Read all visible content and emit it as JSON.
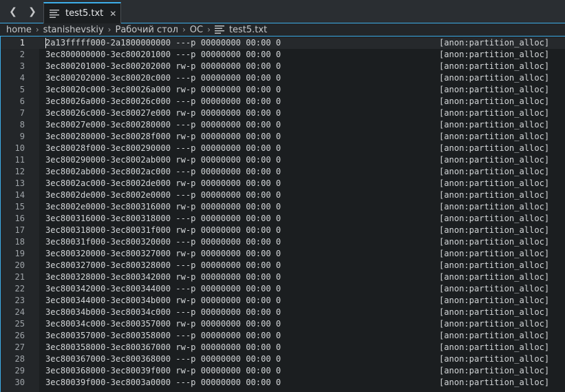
{
  "tab": {
    "label": "test5.txt",
    "close": "✕"
  },
  "nav": {
    "back": "❮",
    "forward": "❯"
  },
  "icons": {
    "back": "chevron-left-icon",
    "forward": "chevron-right-icon",
    "document": "document-text-icon",
    "close": "close-icon",
    "separator": "chevron-right-icon"
  },
  "colors": {
    "accent": "#3daee9",
    "background": "#1b1e20",
    "text": "#d3d6d8"
  },
  "breadcrumb": [
    "home",
    "stanishevskiy",
    "Рабочий стол",
    "ОС",
    "test5.txt"
  ],
  "breadcrumb_sep": "›",
  "lines": [
    {
      "num": "1",
      "text": "2a13fffff000-2a1800000000 ---p 00000000 00:00 0",
      "tag": "[anon:partition_alloc]"
    },
    {
      "num": "2",
      "text": "3ec800000000-3ec800201000 ---p 00000000 00:00 0",
      "tag": "[anon:partition_alloc]"
    },
    {
      "num": "3",
      "text": "3ec800201000-3ec800202000 rw-p 00000000 00:00 0",
      "tag": "[anon:partition_alloc]"
    },
    {
      "num": "4",
      "text": "3ec800202000-3ec80020c000 ---p 00000000 00:00 0",
      "tag": "[anon:partition_alloc]"
    },
    {
      "num": "5",
      "text": "3ec80020c000-3ec80026a000 rw-p 00000000 00:00 0",
      "tag": "[anon:partition_alloc]"
    },
    {
      "num": "6",
      "text": "3ec80026a000-3ec80026c000 ---p 00000000 00:00 0",
      "tag": "[anon:partition_alloc]"
    },
    {
      "num": "7",
      "text": "3ec80026c000-3ec80027e000 rw-p 00000000 00:00 0",
      "tag": "[anon:partition_alloc]"
    },
    {
      "num": "8",
      "text": "3ec80027e000-3ec800280000 ---p 00000000 00:00 0",
      "tag": "[anon:partition_alloc]"
    },
    {
      "num": "9",
      "text": "3ec800280000-3ec80028f000 rw-p 00000000 00:00 0",
      "tag": "[anon:partition_alloc]"
    },
    {
      "num": "10",
      "text": "3ec80028f000-3ec800290000 ---p 00000000 00:00 0",
      "tag": "[anon:partition_alloc]"
    },
    {
      "num": "11",
      "text": "3ec800290000-3ec8002ab000 rw-p 00000000 00:00 0",
      "tag": "[anon:partition_alloc]"
    },
    {
      "num": "12",
      "text": "3ec8002ab000-3ec8002ac000 ---p 00000000 00:00 0",
      "tag": "[anon:partition_alloc]"
    },
    {
      "num": "13",
      "text": "3ec8002ac000-3ec8002de000 rw-p 00000000 00:00 0",
      "tag": "[anon:partition_alloc]"
    },
    {
      "num": "14",
      "text": "3ec8002de000-3ec8002e0000 ---p 00000000 00:00 0",
      "tag": "[anon:partition_alloc]"
    },
    {
      "num": "15",
      "text": "3ec8002e0000-3ec800316000 rw-p 00000000 00:00 0",
      "tag": "[anon:partition_alloc]"
    },
    {
      "num": "16",
      "text": "3ec800316000-3ec800318000 ---p 00000000 00:00 0",
      "tag": "[anon:partition_alloc]"
    },
    {
      "num": "17",
      "text": "3ec800318000-3ec80031f000 rw-p 00000000 00:00 0",
      "tag": "[anon:partition_alloc]"
    },
    {
      "num": "18",
      "text": "3ec80031f000-3ec800320000 ---p 00000000 00:00 0",
      "tag": "[anon:partition_alloc]"
    },
    {
      "num": "19",
      "text": "3ec800320000-3ec800327000 rw-p 00000000 00:00 0",
      "tag": "[anon:partition_alloc]"
    },
    {
      "num": "20",
      "text": "3ec800327000-3ec800328000 ---p 00000000 00:00 0",
      "tag": "[anon:partition_alloc]"
    },
    {
      "num": "21",
      "text": "3ec800328000-3ec800342000 rw-p 00000000 00:00 0",
      "tag": "[anon:partition_alloc]"
    },
    {
      "num": "22",
      "text": "3ec800342000-3ec800344000 ---p 00000000 00:00 0",
      "tag": "[anon:partition_alloc]"
    },
    {
      "num": "23",
      "text": "3ec800344000-3ec80034b000 rw-p 00000000 00:00 0",
      "tag": "[anon:partition_alloc]"
    },
    {
      "num": "24",
      "text": "3ec80034b000-3ec80034c000 ---p 00000000 00:00 0",
      "tag": "[anon:partition_alloc]"
    },
    {
      "num": "25",
      "text": "3ec80034c000-3ec800357000 rw-p 00000000 00:00 0",
      "tag": "[anon:partition_alloc]"
    },
    {
      "num": "26",
      "text": "3ec800357000-3ec800358000 ---p 00000000 00:00 0",
      "tag": "[anon:partition_alloc]"
    },
    {
      "num": "27",
      "text": "3ec800358000-3ec800367000 rw-p 00000000 00:00 0",
      "tag": "[anon:partition_alloc]"
    },
    {
      "num": "28",
      "text": "3ec800367000-3ec800368000 ---p 00000000 00:00 0",
      "tag": "[anon:partition_alloc]"
    },
    {
      "num": "29",
      "text": "3ec800368000-3ec80039f000 rw-p 00000000 00:00 0",
      "tag": "[anon:partition_alloc]"
    },
    {
      "num": "30",
      "text": "3ec80039f000-3ec8003a0000 ---p 00000000 00:00 0",
      "tag": "[anon:partition_alloc]"
    }
  ]
}
